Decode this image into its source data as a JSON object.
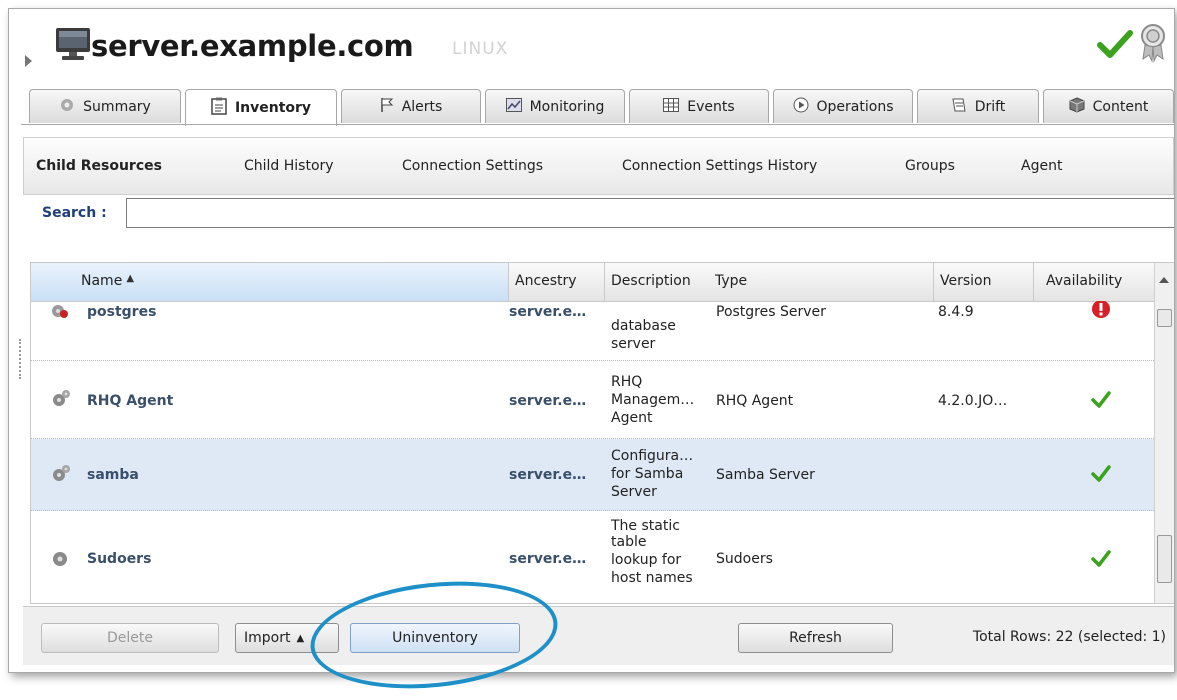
{
  "header": {
    "title": "server.example.com",
    "os": "LINUX",
    "status_color": "#3aa21c"
  },
  "tabs": [
    {
      "label": "Summary",
      "icon": "gear-icon"
    },
    {
      "label": "Inventory",
      "icon": "clipboard-icon",
      "active": true
    },
    {
      "label": "Alerts",
      "icon": "flag-icon"
    },
    {
      "label": "Monitoring",
      "icon": "chart-icon"
    },
    {
      "label": "Events",
      "icon": "grid-icon"
    },
    {
      "label": "Operations",
      "icon": "play-icon"
    },
    {
      "label": "Drift",
      "icon": "drift-icon"
    },
    {
      "label": "Content",
      "icon": "box-icon"
    }
  ],
  "subtabs": [
    "Child Resources",
    "Child History",
    "Connection Settings",
    "Connection Settings History",
    "Groups",
    "Agent"
  ],
  "search": {
    "label": "Search :",
    "value": ""
  },
  "table": {
    "columns": [
      "Name",
      "Ancestry",
      "Description",
      "Type",
      "Version",
      "Availability"
    ],
    "rows": [
      {
        "name": "postgres",
        "ancestry": "server.e…",
        "description": [
          "database",
          "server"
        ],
        "type": "Postgres Server",
        "version": "8.4.9",
        "availability": "down"
      },
      {
        "name": "RHQ Agent",
        "ancestry": "server.e…",
        "description": [
          "RHQ",
          "Managem…",
          "Agent"
        ],
        "type": "RHQ Agent",
        "version": "4.2.0.JO…",
        "availability": "up"
      },
      {
        "name": "samba",
        "ancestry": "server.e…",
        "description": [
          "Configura…",
          "for Samba",
          "Server"
        ],
        "type": "Samba Server",
        "version": "",
        "availability": "up"
      },
      {
        "name": "Sudoers",
        "ancestry": "server.e…",
        "description": [
          "The static",
          "table",
          "lookup for",
          "host names"
        ],
        "type": "Sudoers",
        "version": "",
        "availability": "up"
      }
    ]
  },
  "footer": {
    "delete": "Delete",
    "import": "Import",
    "uninventory": "Uninventory",
    "refresh": "Refresh",
    "total": "Total Rows: 22 (selected: 1)"
  }
}
